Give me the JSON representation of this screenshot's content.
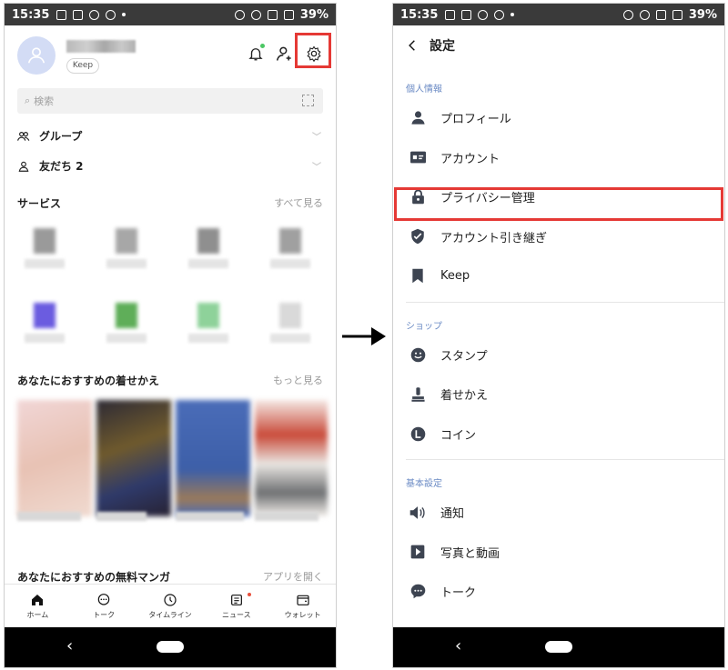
{
  "status": {
    "time": "15:35",
    "battery": "39%"
  },
  "left": {
    "keep_label": "Keep",
    "search_placeholder": "検索",
    "groups_label": "グループ",
    "friends_label": "友だち 2",
    "services_title": "サービス",
    "services_more": "すべて見る",
    "themes_title": "あなたにおすすめの着せかえ",
    "themes_more": "もっと見る",
    "manga_title": "あなたにおすすめの無料マンガ",
    "manga_more": "アプリを開く",
    "tabs": [
      {
        "label": "ホーム",
        "icon": "home-icon"
      },
      {
        "label": "トーク",
        "icon": "chat-icon"
      },
      {
        "label": "タイムライン",
        "icon": "clock-icon"
      },
      {
        "label": "ニュース",
        "icon": "news-icon"
      },
      {
        "label": "ウォレット",
        "icon": "wallet-icon"
      }
    ]
  },
  "right": {
    "title": "設定",
    "groups": [
      {
        "label": "個人情報",
        "items": [
          {
            "label": "プロフィール",
            "icon": "person-icon"
          },
          {
            "label": "アカウント",
            "icon": "id-card-icon"
          },
          {
            "label": "プライバシー管理",
            "icon": "lock-icon"
          },
          {
            "label": "アカウント引き継ぎ",
            "icon": "shield-icon"
          },
          {
            "label": "Keep",
            "icon": "bookmark-icon"
          }
        ]
      },
      {
        "label": "ショップ",
        "items": [
          {
            "label": "スタンプ",
            "icon": "smile-icon"
          },
          {
            "label": "着せかえ",
            "icon": "brush-icon"
          },
          {
            "label": "コイン",
            "icon": "coin-icon"
          }
        ]
      },
      {
        "label": "基本設定",
        "items": [
          {
            "label": "通知",
            "icon": "speaker-icon"
          },
          {
            "label": "写真と動画",
            "icon": "play-icon"
          },
          {
            "label": "トーク",
            "icon": "chat-bubble-icon"
          }
        ]
      }
    ]
  },
  "colors": {
    "highlight": "#e53935",
    "group_label": "#6a8ac4",
    "icon_dark": "#3d4451"
  }
}
